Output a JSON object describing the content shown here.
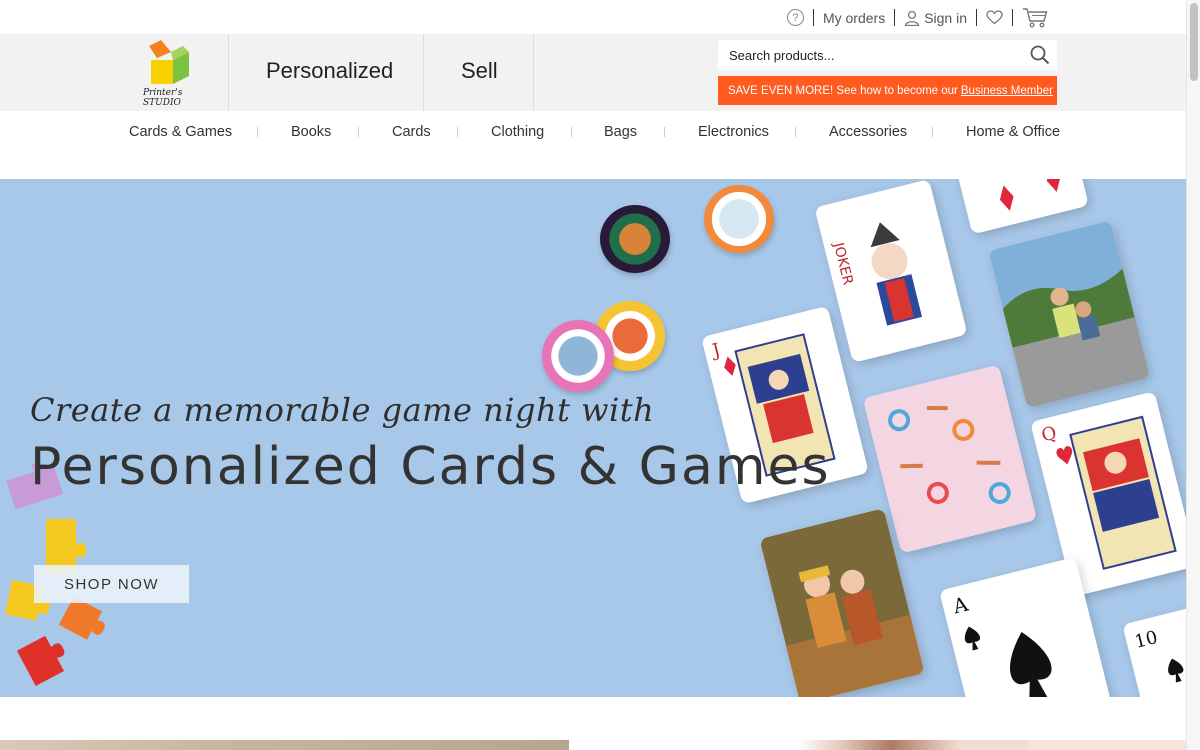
{
  "topbar": {
    "help_icon": "question-circle-icon",
    "my_orders": "My orders",
    "sign_in": "Sign in",
    "user_icon": "user-icon",
    "wishlist_icon": "heart-icon",
    "cart_icon": "cart-icon"
  },
  "header": {
    "logo_text_1": "Printer's",
    "logo_text_2": "STUDIO",
    "links": [
      "Personalized",
      "Sell"
    ],
    "search": {
      "placeholder": "Search products...",
      "icon": "search-icon"
    },
    "promo": {
      "text": "SAVE EVEN MORE! See how to become our",
      "link": "Business Member"
    }
  },
  "categories": [
    "Cards & Games",
    "Books",
    "Cards",
    "Clothing",
    "Bags",
    "Electronics",
    "Accessories",
    "Home & Office"
  ],
  "hero": {
    "subtitle": "Create a memorable game night with",
    "title": "Personalized Cards & Games",
    "cta": "SHOP NOW"
  },
  "colors": {
    "accent": "#ff5a1f",
    "hero_bg": "#a8c8ea",
    "header_bg": "#f2f2f2"
  }
}
